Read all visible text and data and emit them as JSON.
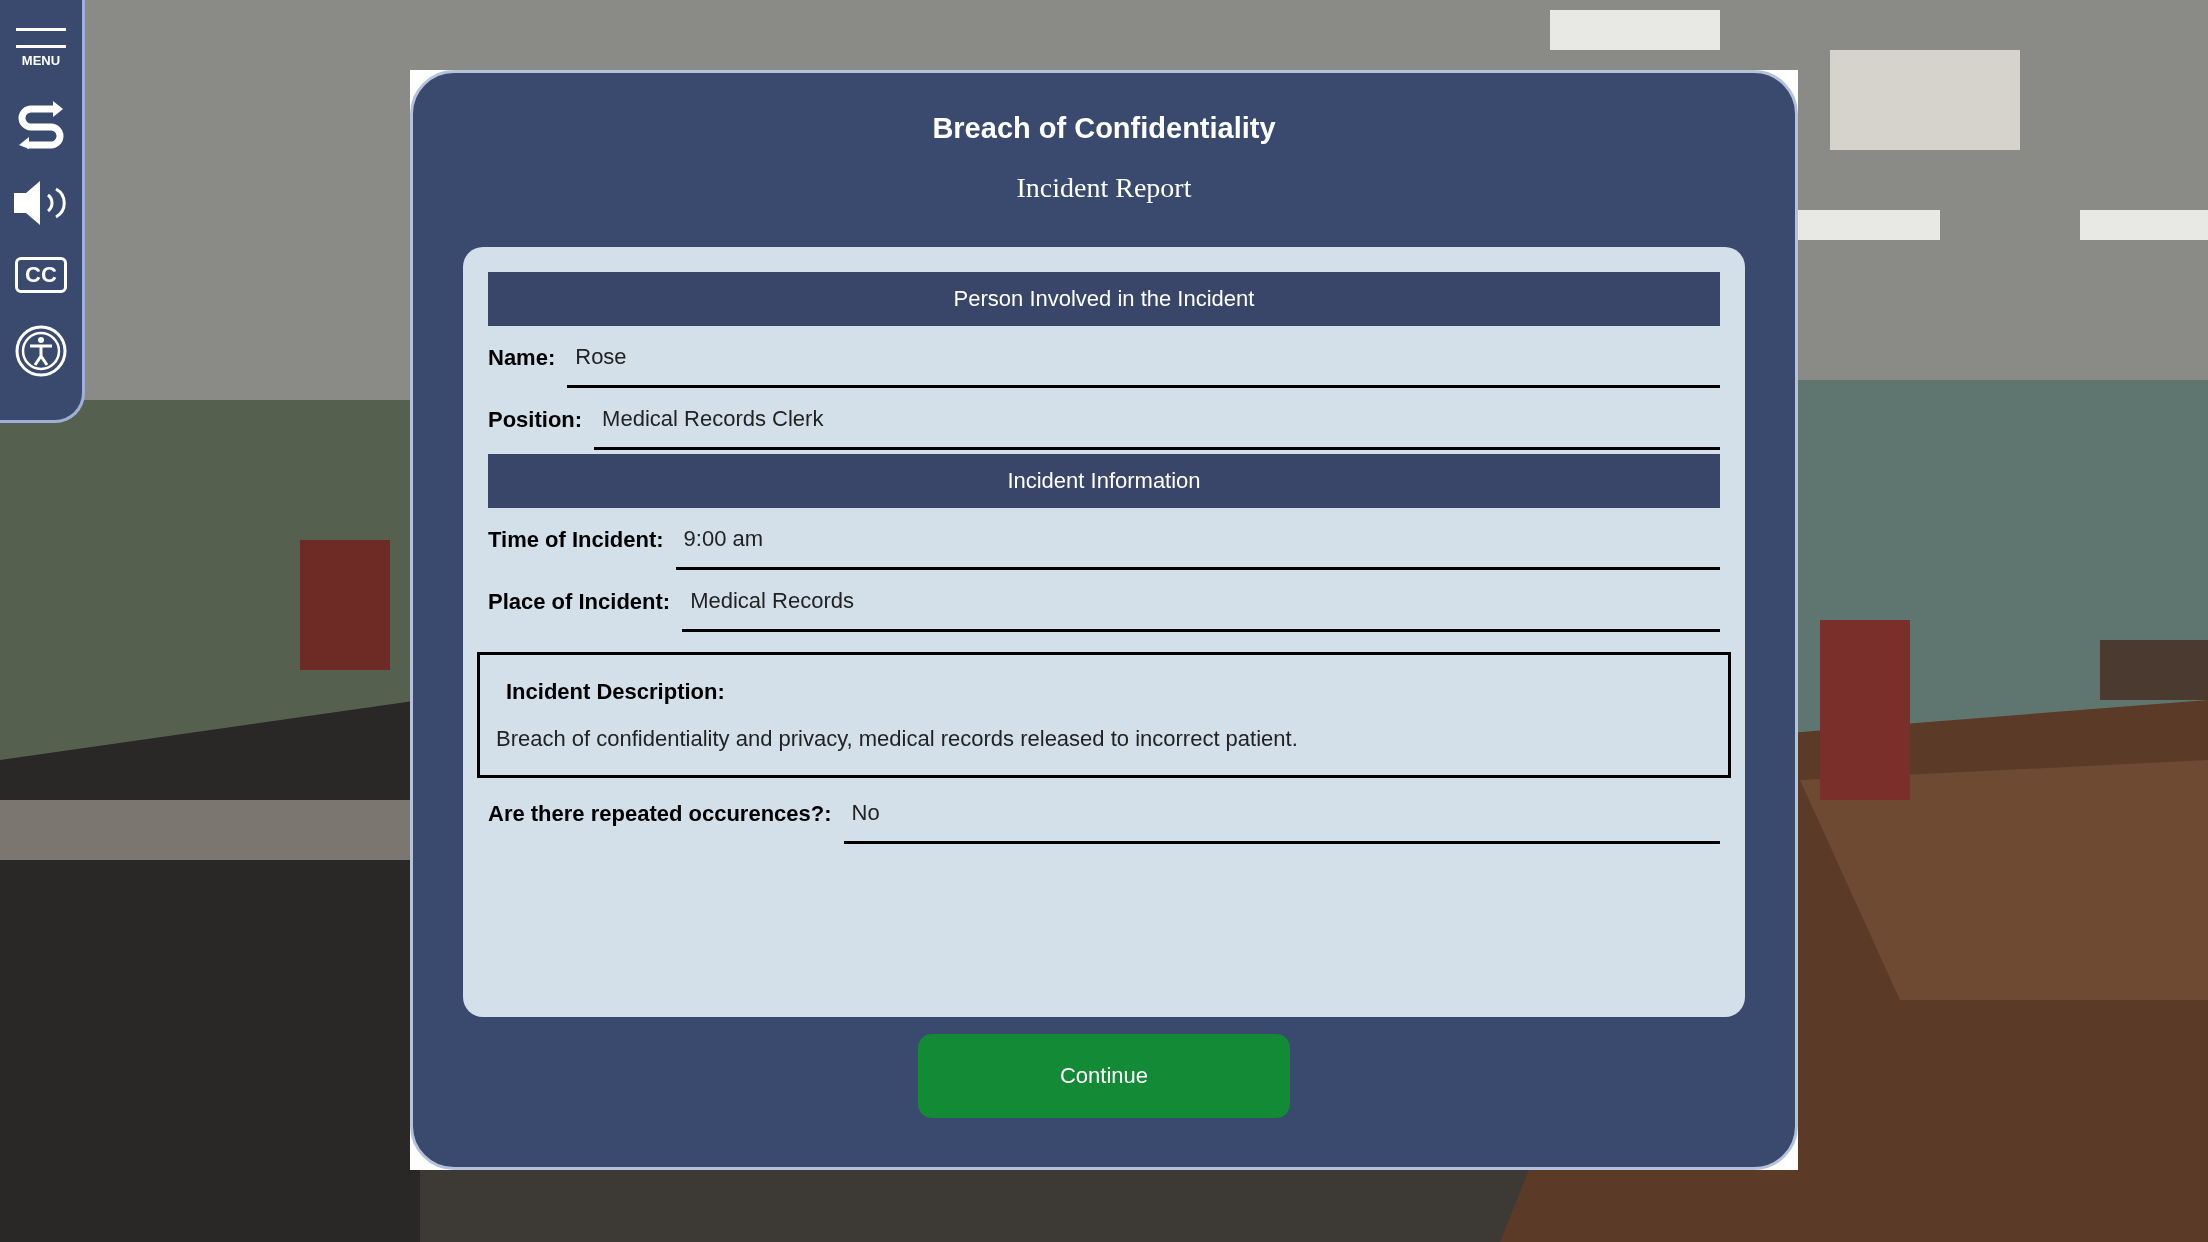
{
  "sidebar": {
    "items": [
      {
        "kind": "menu",
        "label": "MENU"
      },
      {
        "kind": "replay"
      },
      {
        "kind": "audio"
      },
      {
        "kind": "captions",
        "label": "CC"
      },
      {
        "kind": "accessibility"
      }
    ]
  },
  "dialog": {
    "title": "Breach of Confidentiality",
    "subtitle": "Incident Report",
    "form": [
      {
        "kind": "header",
        "text": "Person Involved in the Incident"
      },
      {
        "kind": "field",
        "label": "Name:",
        "value": "Rose"
      },
      {
        "kind": "field",
        "label": "Position:",
        "value": "Medical Records Clerk"
      },
      {
        "kind": "header",
        "text": "Incident Information"
      },
      {
        "kind": "field",
        "label": "Time of Incident:",
        "value": "9:00 am"
      },
      {
        "kind": "field",
        "label": "Place of Incident:",
        "value": "Medical Records"
      },
      {
        "kind": "description",
        "label": "Incident Description:",
        "value": "Breach of confidentiality and privacy, medical records released to incorrect patient."
      },
      {
        "kind": "field",
        "label": "Are there repeated occurences?:",
        "value": "No"
      }
    ],
    "button": "Continue"
  }
}
